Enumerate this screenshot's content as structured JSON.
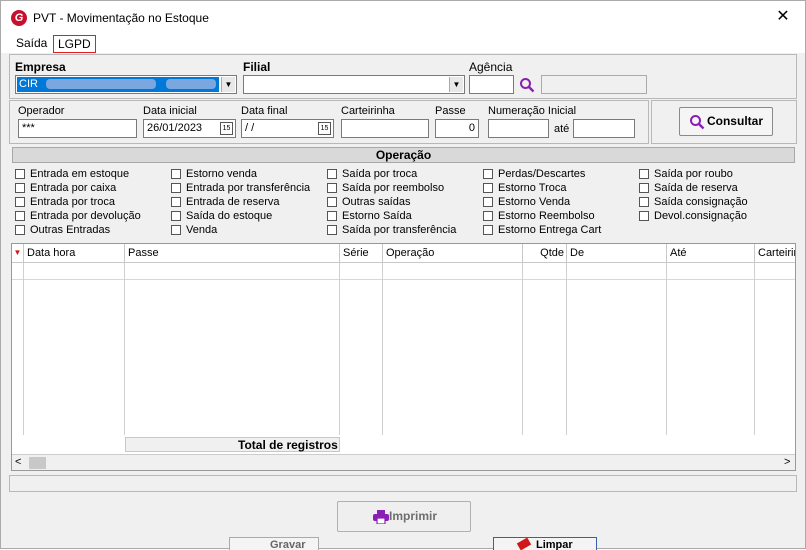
{
  "window": {
    "title": "PVT - Movimentação no Estoque",
    "close_glyph": "✕",
    "logo_letter": "G"
  },
  "menu": {
    "items": [
      "Saída",
      "LGPD"
    ]
  },
  "empresa": {
    "label": "Empresa",
    "value": "CIR"
  },
  "filial": {
    "label": "Filial",
    "value": ""
  },
  "agencia": {
    "label": "Agência",
    "value": "",
    "name_value": ""
  },
  "filters": {
    "operador": {
      "label": "Operador",
      "value": "***"
    },
    "data_inicial": {
      "label": "Data inicial",
      "value": "26/01/2023"
    },
    "data_final": {
      "label": "Data final",
      "value": " /  /"
    },
    "carteirinha": {
      "label": "Carteirinha",
      "value": ""
    },
    "passe": {
      "label": "Passe",
      "value": "0"
    },
    "numeracao": {
      "label": "Numeração Inicial",
      "value": "",
      "ate_label": "até",
      "ate_value": ""
    },
    "date_icon_text": "15"
  },
  "consultar_label": "Consultar",
  "operacao": {
    "title": "Operação",
    "columns": [
      [
        "Entrada em estoque",
        "Entrada por caixa",
        "Entrada por troca",
        "Entrada por devolução",
        "Outras Entradas"
      ],
      [
        "Estorno venda",
        "Entrada por transferência",
        "Entrada de reserva",
        "Saída do estoque",
        "Venda"
      ],
      [
        "Saída por troca",
        "Saída por reembolso",
        "Outras saídas",
        "Estorno Saída",
        "Saída por transferência"
      ],
      [
        "Perdas/Descartes",
        "Estorno Troca",
        "Estorno Venda",
        "Estorno Reembolso",
        "Estorno Entrega Cart"
      ],
      [
        "Saída por roubo",
        "Saída de reserva",
        "Saída consignação",
        "Devol.consignação"
      ]
    ]
  },
  "grid": {
    "columns": [
      "Data hora",
      "Passe",
      "Série",
      "Operação",
      "Qtde",
      "De",
      "Até",
      "Carteirin"
    ],
    "total_label": "Total de registros"
  },
  "imprimir_label": "Imprimir",
  "background_buttons": {
    "gravar": "Gravar",
    "limpar": "Limpar"
  },
  "colors": {
    "accent_purple": "#8a1fb5",
    "selection_blue": "#0078d7",
    "lgpd_highlight": "#e02020"
  }
}
